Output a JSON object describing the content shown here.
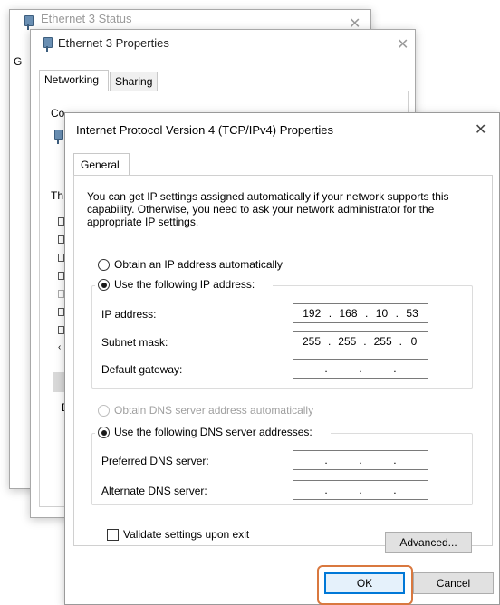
{
  "window1": {
    "title": "Ethernet 3 Status",
    "frag_left": "G"
  },
  "window2": {
    "title": "Ethernet 3 Properties",
    "tabs": [
      "Networking",
      "Sharing"
    ],
    "connect_fragment": "Co",
    "this_fragment": "Th",
    "desc_fragment": "D"
  },
  "dialog": {
    "title": "Internet Protocol Version 4 (TCP/IPv4) Properties",
    "tab": "General",
    "description": "You can get IP settings assigned automatically if your network supports this capability. Otherwise, you need to ask your network administrator for the appropriate IP settings.",
    "ip_mode": {
      "auto_label": "Obtain an IP address automatically",
      "manual_label": "Use the following IP address:",
      "selected": "manual"
    },
    "fields": {
      "ip_label": "IP address:",
      "ip_value": [
        "192",
        "168",
        "10",
        "53"
      ],
      "subnet_label": "Subnet mask:",
      "subnet_value": [
        "255",
        "255",
        "255",
        "0"
      ],
      "gateway_label": "Default gateway:",
      "gateway_value": [
        "",
        "",
        "",
        ""
      ]
    },
    "dns_mode": {
      "auto_label": "Obtain DNS server address automatically",
      "manual_label": "Use the following DNS server addresses:",
      "selected": "manual"
    },
    "dns": {
      "preferred_label": "Preferred DNS server:",
      "alternate_label": "Alternate DNS server:"
    },
    "validate_label": "Validate settings upon exit",
    "advanced_label": "Advanced...",
    "ok_label": "OK",
    "cancel_label": "Cancel",
    "ok_highlight_color": "#d9783f"
  }
}
